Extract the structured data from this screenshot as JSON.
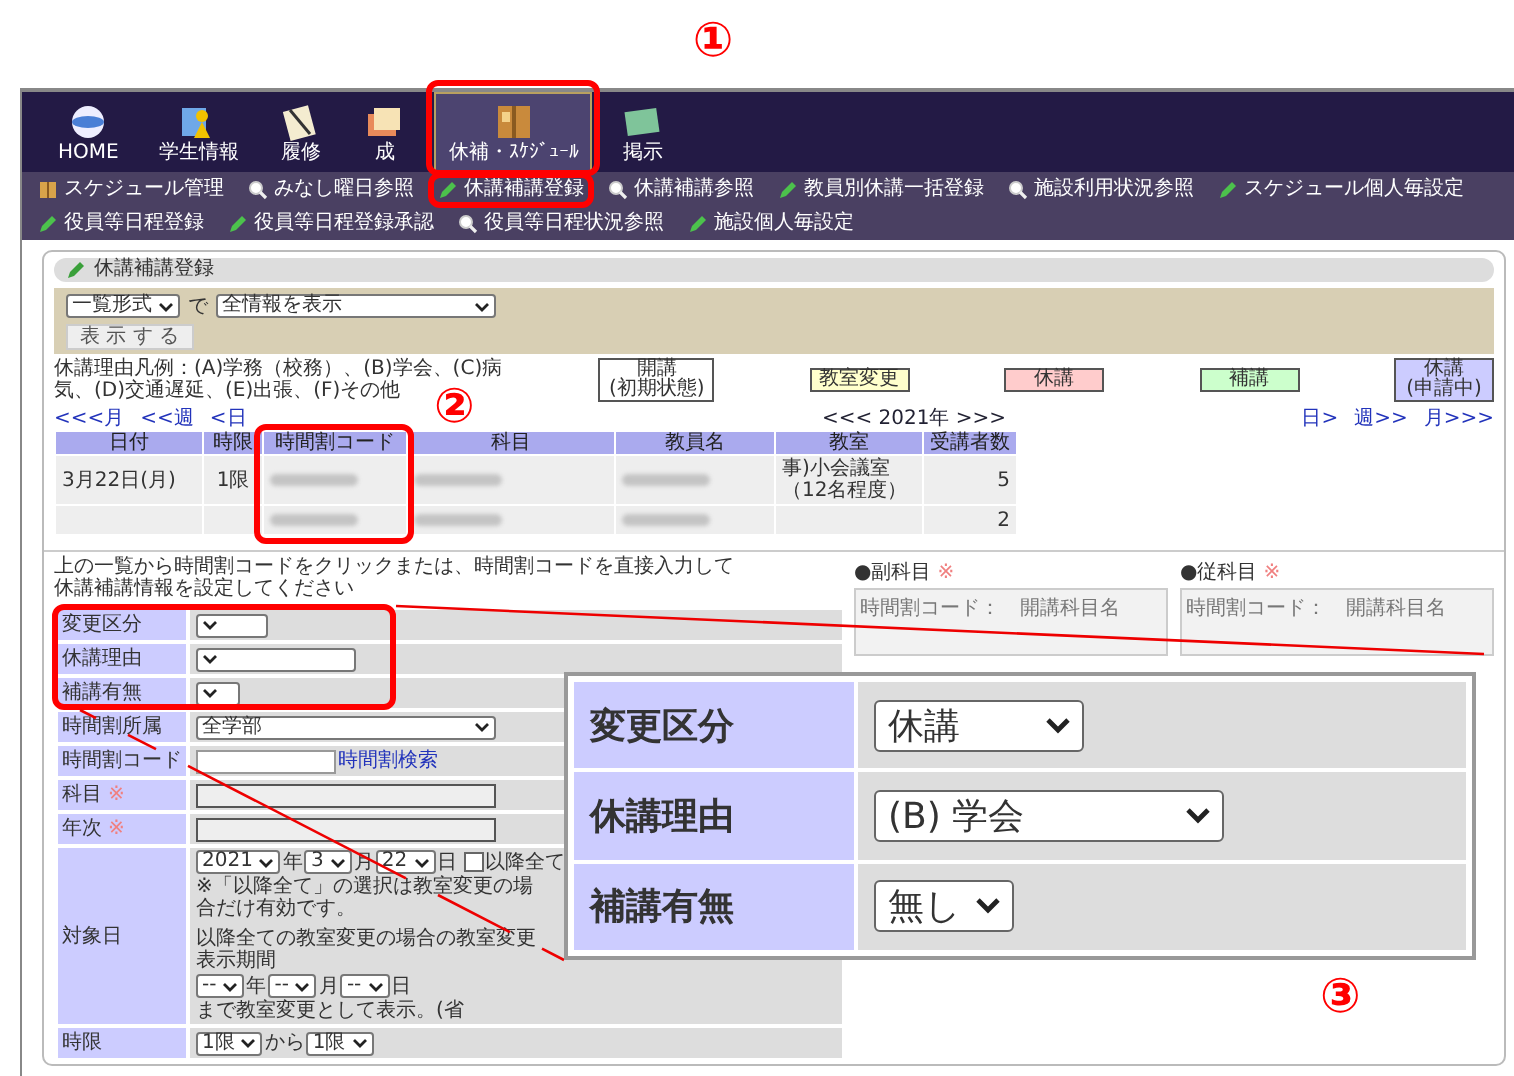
{
  "nav": {
    "items": [
      {
        "label": "HOME",
        "selected": false,
        "highlighted": false
      },
      {
        "label": "学生情報",
        "selected": false,
        "highlighted": false
      },
      {
        "label": "履修",
        "selected": false,
        "highlighted": false
      },
      {
        "label": "成",
        "selected": false,
        "highlighted": false
      },
      {
        "label": "休補・ｽｹｼﾞｭｰﾙ",
        "selected": true,
        "highlighted": true
      },
      {
        "label": "掲示",
        "selected": false,
        "highlighted": false
      }
    ]
  },
  "submenu": {
    "items": [
      {
        "label": "スケジュール管理",
        "highlighted": false
      },
      {
        "label": "みなし曜日参照",
        "highlighted": false
      },
      {
        "label": "休講補講登録",
        "highlighted": true
      },
      {
        "label": "休講補講参照",
        "highlighted": false
      },
      {
        "label": "教員別休講一括登録",
        "highlighted": false
      },
      {
        "label": "施設利用状況参照",
        "highlighted": false
      },
      {
        "label": "スケジュール個人毎設定",
        "highlighted": false
      },
      {
        "label": "役員等日程登録",
        "highlighted": false
      },
      {
        "label": "役員等日程登録承認",
        "highlighted": false
      },
      {
        "label": "役員等日程状況参照",
        "highlighted": false
      },
      {
        "label": "施設個人毎設定",
        "highlighted": false
      }
    ]
  },
  "panel": {
    "title": "休講補講登録"
  },
  "filter": {
    "format": "一覧形式",
    "connector": "で",
    "scope": "全情報を表示",
    "button": "表 示 す る"
  },
  "legend": {
    "text": "休講理由凡例：(A)学務（校務）、(B)学会、(C)病気、(D)交通遅延、(E)出張、(F)その他",
    "items": [
      {
        "label": "開講",
        "sub": "(初期状態)",
        "color": "#ffffff"
      },
      {
        "label": "教室変更",
        "color": "#ffffcc"
      },
      {
        "label": "休講",
        "color": "#ffcccc"
      },
      {
        "label": "補講",
        "color": "#ccffcc"
      },
      {
        "label": "休講",
        "sub": "(申請中)",
        "color": "#ccccff"
      }
    ]
  },
  "calendar_nav": {
    "prev": [
      "<<<月",
      "<<週",
      "<日"
    ],
    "period": "<<< 2021年 >>>",
    "next": [
      "日>",
      "週>>",
      "月>>>"
    ]
  },
  "table": {
    "columns": [
      {
        "label": "日付",
        "highlighted": false
      },
      {
        "label": "時限",
        "highlighted": false
      },
      {
        "label": "時間割コード",
        "highlighted": true
      },
      {
        "label": "科目",
        "highlighted": false
      },
      {
        "label": "教員名",
        "highlighted": false
      },
      {
        "label": "教室",
        "highlighted": false
      },
      {
        "label": "受講者数",
        "highlighted": false
      }
    ],
    "rows": [
      {
        "cells": [
          {
            "kind": "text",
            "text": "3月22日(月)"
          },
          {
            "kind": "text",
            "text": "1限"
          },
          {
            "kind": "blurred"
          },
          {
            "kind": "blurred"
          },
          {
            "kind": "blurred"
          },
          {
            "kind": "text",
            "text": "事)小会議室（12名程度）"
          },
          {
            "kind": "number",
            "text": "5"
          }
        ]
      },
      {
        "cells": [
          {
            "kind": "empty"
          },
          {
            "kind": "empty"
          },
          {
            "kind": "blurred"
          },
          {
            "kind": "blurred"
          },
          {
            "kind": "blurred"
          },
          {
            "kind": "empty"
          },
          {
            "kind": "number",
            "text": "2"
          }
        ]
      }
    ]
  },
  "instructions": [
    "上の一覧から時間割コードをクリックまたは、時間割コードを直接入力して",
    "休講補講情報を設定してください"
  ],
  "form": {
    "groups": [
      {
        "highlighted": true,
        "rows": [
          {
            "kind": "select",
            "label": "変更区分"
          },
          {
            "kind": "select",
            "label": "休講理由"
          },
          {
            "kind": "select",
            "label": "補講有無"
          }
        ]
      },
      {
        "highlighted": false,
        "rows": [
          {
            "kind": "select",
            "label": "時間割所属",
            "value": "全学部"
          },
          {
            "kind": "code",
            "label": "時間割コード",
            "link": "時間割検索"
          },
          {
            "kind": "readonly",
            "label": "科目",
            "mark": "※"
          },
          {
            "kind": "readonly",
            "label": "年次",
            "mark": "※"
          },
          {
            "kind": "date",
            "label": "対象日",
            "year": "2021",
            "year_unit": "年",
            "month": "3",
            "month_unit": "月",
            "day": "22",
            "day_unit": "日",
            "checkbox": {
              "label": "以降全て",
              "checked": false
            },
            "note": "※「以降全て」の選択は教室変更の場合だけ有効です。",
            "period_label": "以降全ての教室変更の場合の教室変更表示期間",
            "until_year": "--",
            "until_year_unit": "年",
            "until_month": "--",
            "until_month_unit": "月",
            "until_day": "--",
            "until_day_unit": "日",
            "until_text": "まで教室変更として表示。(省"
          },
          {
            "kind": "period",
            "label": "時限",
            "from": "1限",
            "connector": "から",
            "to": "1限"
          }
        ]
      }
    ]
  },
  "side_panels": [
    {
      "title": "●副科目",
      "mark": "※",
      "placeholder": "時間割コード：　開講科目名"
    },
    {
      "title": "●従科目",
      "mark": "※",
      "placeholder": "時間割コード：　開講科目名"
    }
  ],
  "callout": {
    "rows": [
      {
        "label": "変更区分",
        "value": "休講"
      },
      {
        "label": "休講理由",
        "value": "(B) 学会"
      },
      {
        "label": "補講有無",
        "value": "無し"
      }
    ]
  },
  "annotations": {
    "markers": [
      "①",
      "②",
      "③"
    ]
  }
}
